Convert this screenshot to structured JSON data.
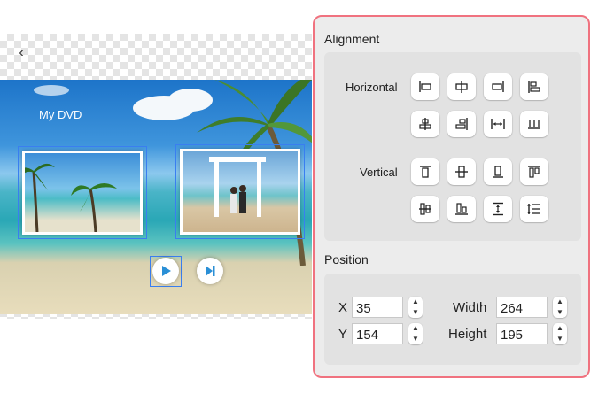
{
  "menu": {
    "title": "My DVD"
  },
  "toolbar": {
    "back_icon": "chevron-left-icon"
  },
  "inspector": {
    "alignment": {
      "title": "Alignment",
      "horizontal_label": "Horizontal",
      "vertical_label": "Vertical"
    },
    "position": {
      "title": "Position",
      "x_label": "X",
      "x_value": "35",
      "y_label": "Y",
      "y_value": "154",
      "width_label": "Width",
      "width_value": "264",
      "height_label": "Height",
      "height_value": "195"
    }
  },
  "colors": {
    "panel_border": "#f0727f",
    "selection": "#3a7ef0"
  }
}
